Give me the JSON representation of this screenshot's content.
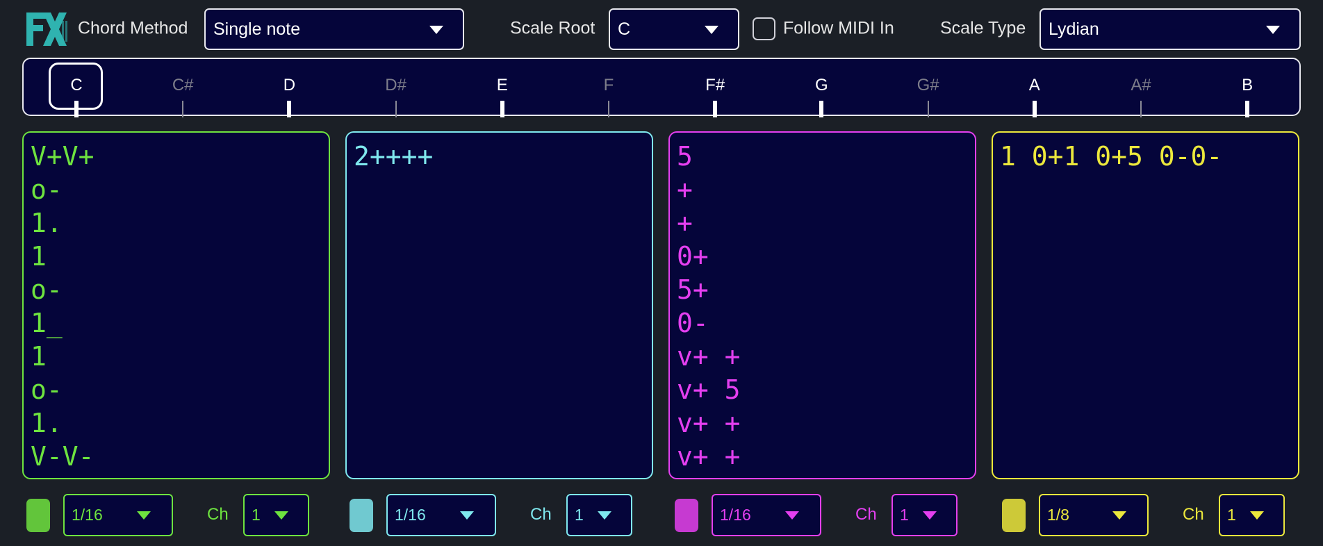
{
  "colors": {
    "green": "#6ee33f",
    "cyan": "#7fe8ee",
    "magenta": "#e43ff0",
    "yellow": "#ece83c"
  },
  "header": {
    "logo_icon": "fx-logo-icon",
    "chord_method_label": "Chord Method",
    "chord_method_value": "Single note",
    "scale_root_label": "Scale Root",
    "scale_root_value": "C",
    "follow_midi_label": "Follow MIDI In",
    "follow_midi_checked": false,
    "scale_type_label": "Scale Type",
    "scale_type_value": "Lydian"
  },
  "keyboard": {
    "selected": "C",
    "keys": [
      {
        "name": "C",
        "in_scale": true
      },
      {
        "name": "C#",
        "in_scale": false
      },
      {
        "name": "D",
        "in_scale": true
      },
      {
        "name": "D#",
        "in_scale": false
      },
      {
        "name": "E",
        "in_scale": true
      },
      {
        "name": "F",
        "in_scale": false
      },
      {
        "name": "F#",
        "in_scale": true
      },
      {
        "name": "G",
        "in_scale": true
      },
      {
        "name": "G#",
        "in_scale": false
      },
      {
        "name": "A",
        "in_scale": true
      },
      {
        "name": "A#",
        "in_scale": false
      },
      {
        "name": "B",
        "in_scale": true
      }
    ]
  },
  "tracks": [
    {
      "color": "green",
      "lines": [
        "V+V+",
        "o-",
        "1.",
        "1",
        "o-",
        "1_",
        "1",
        "o-",
        "1.",
        "V-V-"
      ],
      "division": "1/16",
      "ch_label": "Ch",
      "channel": "1"
    },
    {
      "color": "cyan",
      "lines": [
        "2++++"
      ],
      "division": "1/16",
      "ch_label": "Ch",
      "channel": "1"
    },
    {
      "color": "magenta",
      "lines": [
        "5",
        "+",
        "+",
        "0+",
        "5+",
        "0-",
        "v+ +",
        "v+ 5",
        "v+ +",
        "v+ +"
      ],
      "division": "1/16",
      "ch_label": "Ch",
      "channel": "1"
    },
    {
      "color": "yellow",
      "lines": [
        "1 0+1 0+5 0-0-"
      ],
      "division": "1/8",
      "ch_label": "Ch",
      "channel": "1"
    }
  ]
}
